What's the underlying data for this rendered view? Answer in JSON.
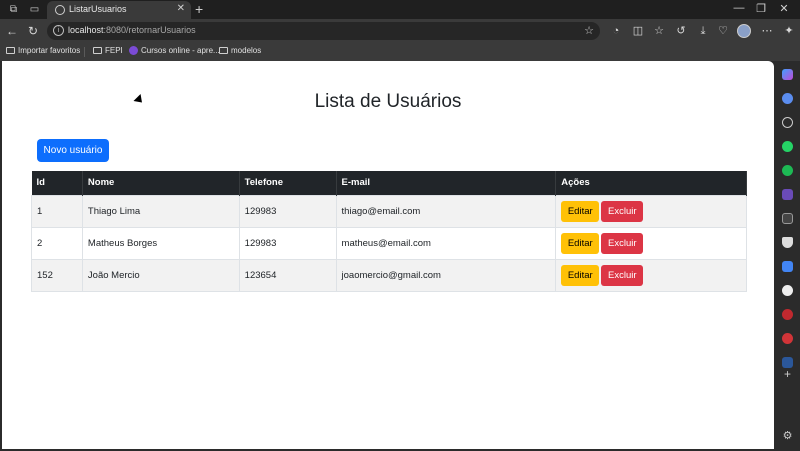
{
  "browser": {
    "tab_title": "ListarUsuarios",
    "url_host": "localhost",
    "url_rest": ":8080/retornarUsuarios"
  },
  "bookmarks": [
    {
      "label": "Importar favoritos"
    },
    {
      "label": "FEPI"
    },
    {
      "label": "Cursos online - apre..."
    },
    {
      "label": "modelos"
    }
  ],
  "page": {
    "title": "Lista de Usuários",
    "new_user_label": "Novo usuário"
  },
  "table": {
    "headers": [
      "Id",
      "Nome",
      "Telefone",
      "E-mail",
      "Ações"
    ],
    "rows": [
      {
        "id": "1",
        "nome": "Thiago Lima",
        "telefone": "129983",
        "email": "thiago@email.com"
      },
      {
        "id": "2",
        "nome": "Matheus Borges",
        "telefone": "129983",
        "email": "matheus@email.com"
      },
      {
        "id": "152",
        "nome": "João Mercio",
        "telefone": "123654",
        "email": "joaomercio@gmail.com"
      }
    ],
    "edit_label": "Editar",
    "delete_label": "Excluir"
  },
  "colors": {
    "primary": "#0d6efd",
    "warning": "#ffc107",
    "danger": "#dc3545",
    "table_header": "#212529"
  },
  "icons": {
    "tab_favicon": "globe-icon",
    "sidebar": [
      "copilot-icon",
      "telegram-icon",
      "search-icon",
      "whatsapp-icon",
      "spotify-icon",
      "app-icon",
      "app-icon",
      "shield-icon",
      "google-icon",
      "github-icon",
      "app-icon",
      "app-icon",
      "translate-icon",
      "add-icon",
      "settings-icon"
    ]
  }
}
